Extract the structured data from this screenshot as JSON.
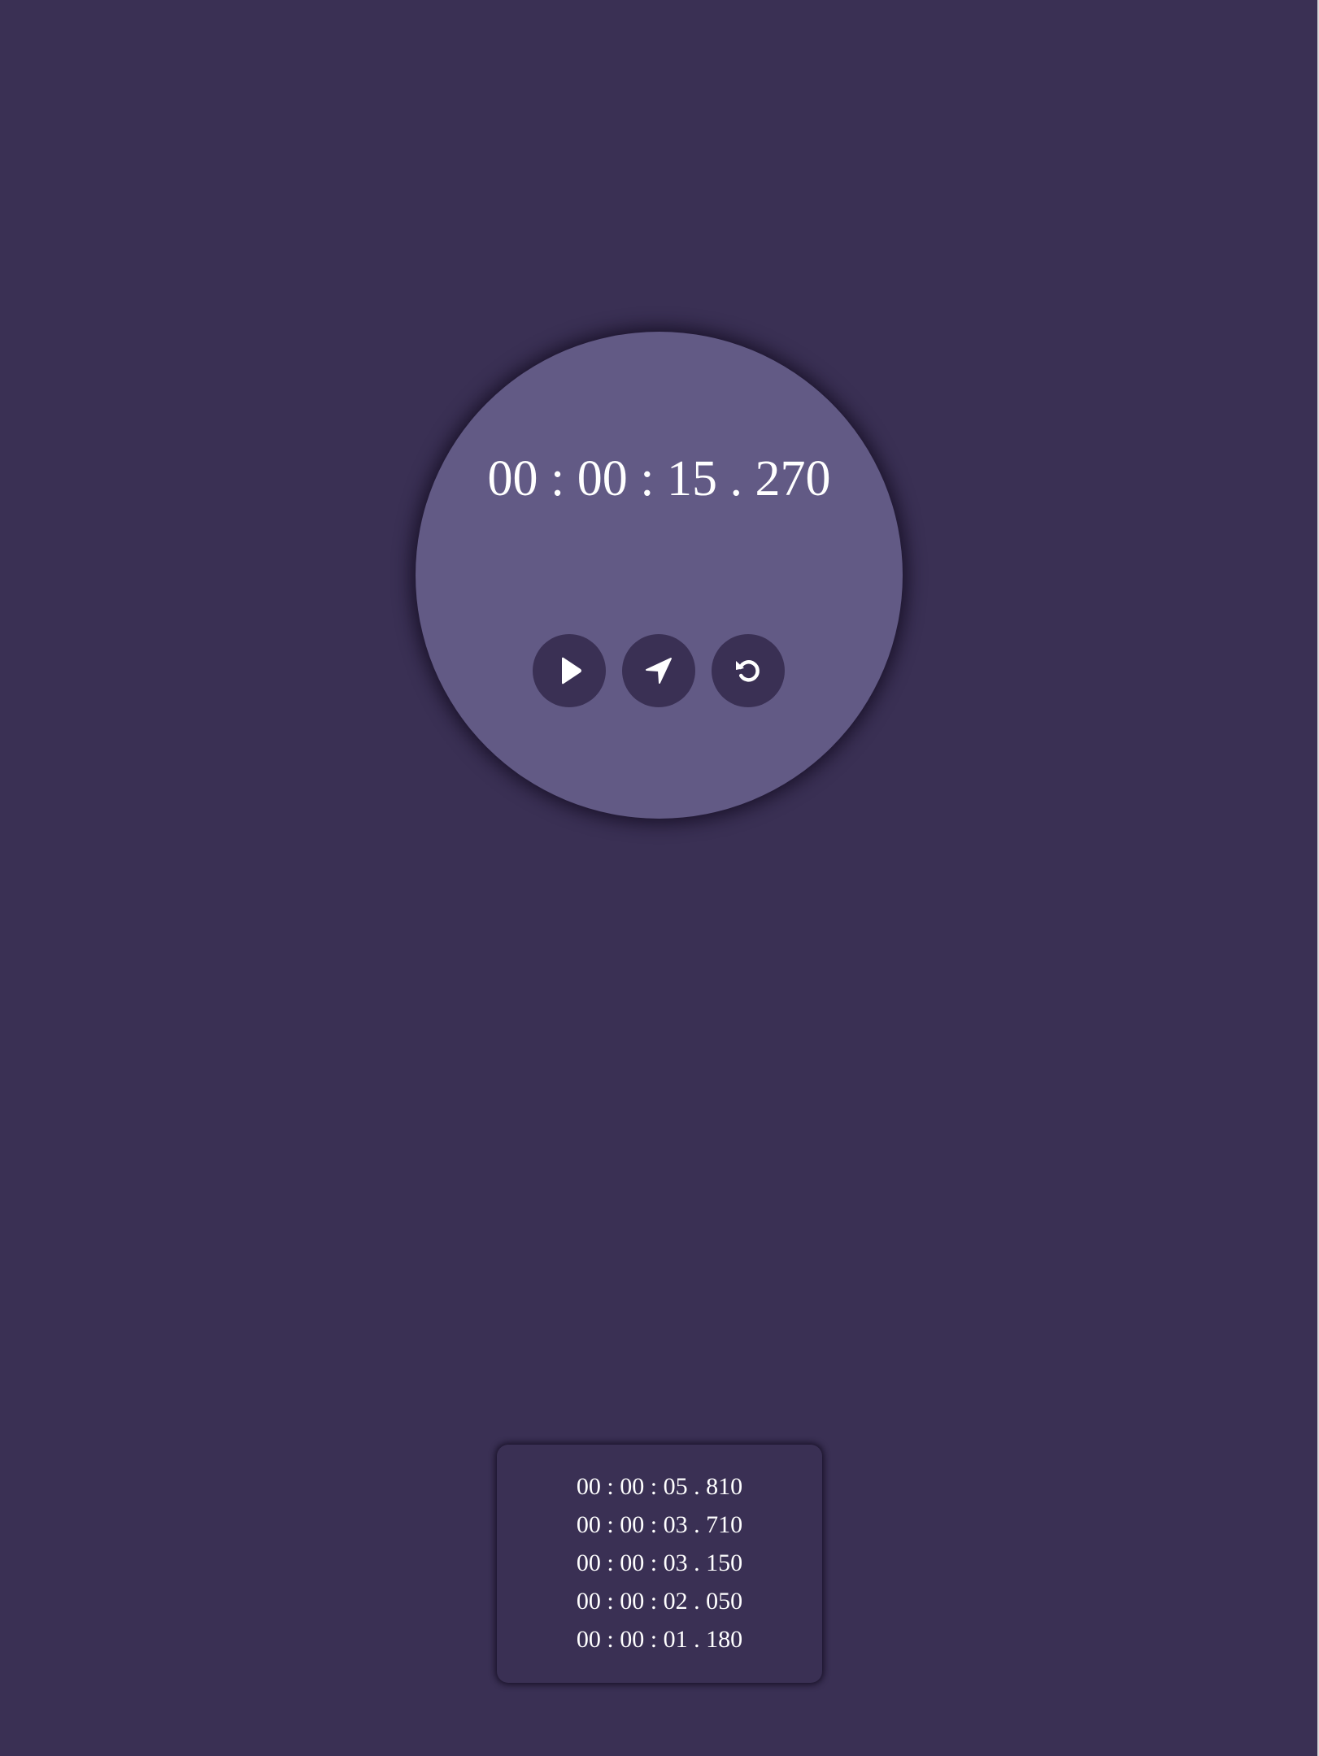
{
  "stopwatch": {
    "time": "00 : 00 : 15 . 270",
    "controls": {
      "start": {
        "icon": "play-icon"
      },
      "lap": {
        "icon": "location-arrow-icon"
      },
      "reset": {
        "icon": "reset-icon"
      }
    }
  },
  "laps": [
    "00 : 00 : 05 . 810",
    "00 : 00 : 03 . 710",
    "00 : 00 : 03 . 150",
    "00 : 00 : 02 . 050",
    "00 : 00 : 01 . 180"
  ],
  "colors": {
    "background": "#3a3054",
    "dial": "#625a85",
    "button": "#3a3054",
    "text": "#ffffff"
  }
}
